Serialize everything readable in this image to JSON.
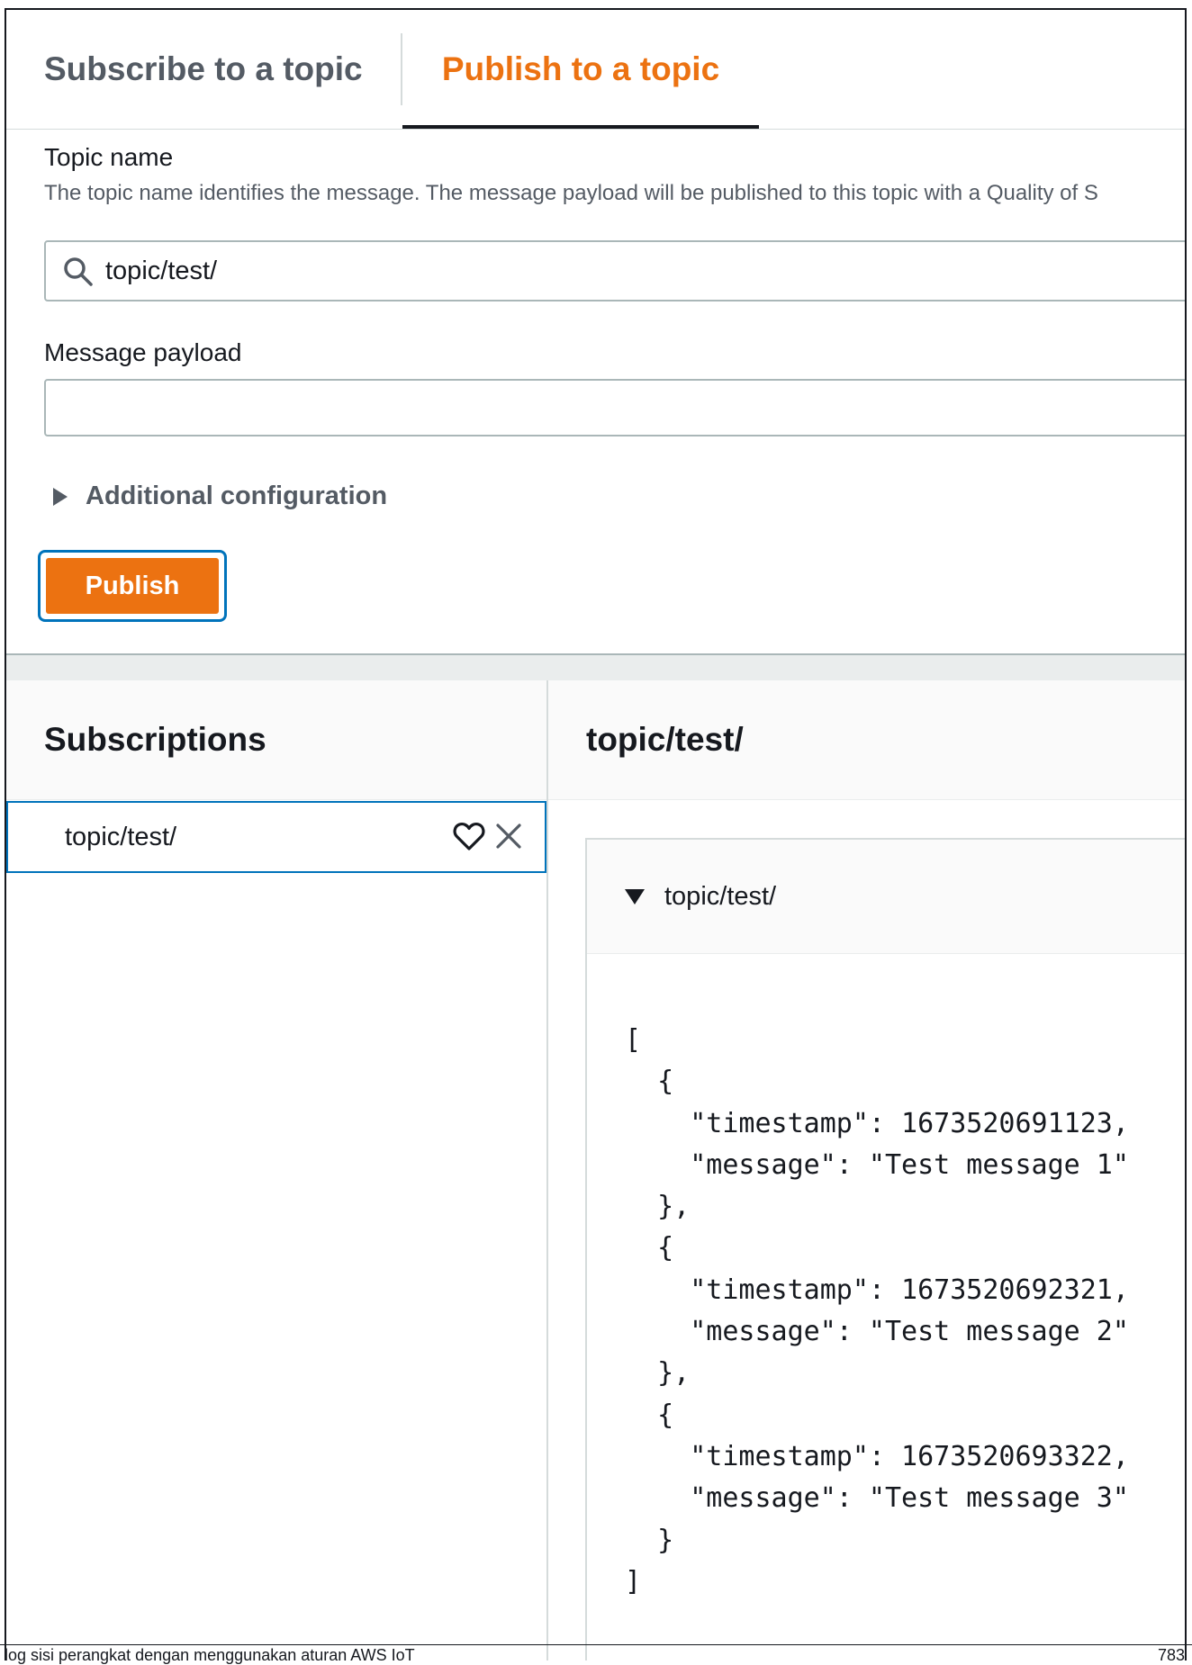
{
  "tabs": [
    {
      "label": "Subscribe to a topic",
      "active": false
    },
    {
      "label": "Publish to a topic",
      "active": true
    }
  ],
  "publish_form": {
    "topic_label": "Topic name",
    "topic_description": "The topic name identifies the message. The message payload will be published to this topic with a Quality of S",
    "topic_value": "topic/test/",
    "payload_label": "Message payload",
    "payload_value": "",
    "additional_config_label": "Additional configuration",
    "publish_button_label": "Publish"
  },
  "subscriptions": {
    "title": "Subscriptions",
    "items": [
      {
        "label": "topic/test/"
      }
    ]
  },
  "messages": {
    "title": "topic/test/",
    "card_label": "topic/test/",
    "payload": "[\n  {\n    \"timestamp\": 1673520691123,\n    \"message\": \"Test message 1\"\n  },\n  {\n    \"timestamp\": 1673520692321,\n    \"message\": \"Test message 2\"\n  },\n  {\n    \"timestamp\": 1673520693322,\n    \"message\": \"Test message 3\"\n  }\n]"
  },
  "footer": {
    "left": "log sisi perangkat dengan menggunakan aturan AWS IoT",
    "right": "783"
  },
  "colors": {
    "accent_orange": "#ec7211",
    "focus_blue": "#0073bb",
    "text_dark": "#16191f",
    "text_muted": "#545b64"
  },
  "icons": [
    "search-icon",
    "caret-right-icon",
    "heart-icon",
    "close-icon",
    "caret-down-icon"
  ]
}
